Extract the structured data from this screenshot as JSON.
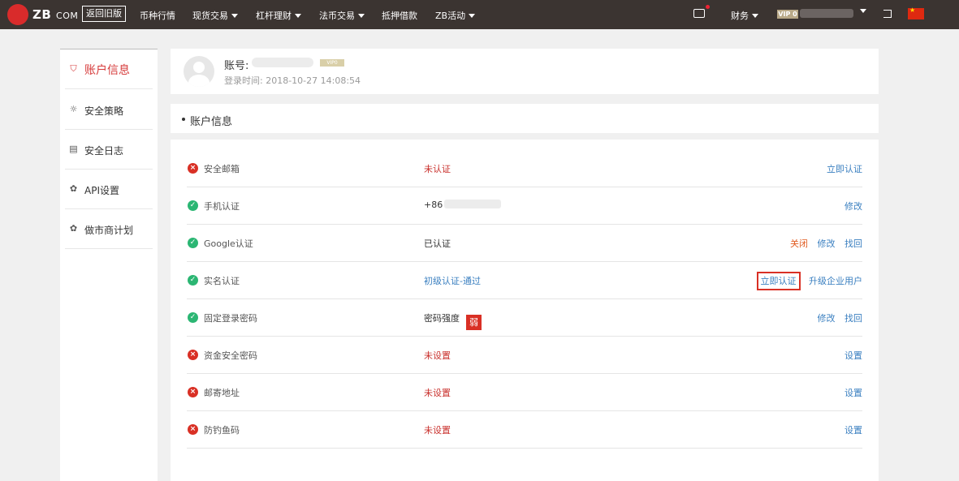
{
  "topbar": {
    "logo_text": "ZB",
    "logo_suffix": "COM",
    "old_version": "返回旧版",
    "nav": [
      {
        "label": "币种行情",
        "dropdown": false
      },
      {
        "label": "现货交易",
        "dropdown": true
      },
      {
        "label": "杠杆理财",
        "dropdown": true
      },
      {
        "label": "法币交易",
        "dropdown": true
      },
      {
        "label": "抵押借款",
        "dropdown": false
      },
      {
        "label": "ZB活动",
        "dropdown": true
      }
    ],
    "finance": "财务",
    "vip": "VIP 0",
    "message_icon": "message-icon",
    "logout_icon": "logout-icon",
    "flag_icon": "china-flag-icon"
  },
  "sidebar": {
    "items": [
      {
        "label": "账户信息",
        "icon": "user-icon",
        "active": true
      },
      {
        "label": "安全策略",
        "icon": "bulb-icon",
        "active": false
      },
      {
        "label": "安全日志",
        "icon": "document-icon",
        "active": false
      },
      {
        "label": "API设置",
        "icon": "api-icon",
        "active": false
      },
      {
        "label": "做市商计划",
        "icon": "api-icon",
        "active": false
      }
    ]
  },
  "profile": {
    "account_label": "账号:",
    "vip_tag": "VIP0",
    "login_time": "登录时间: 2018-10-27 14:08:54"
  },
  "section": {
    "title": "账户信息"
  },
  "rows": [
    {
      "name": "安全邮箱",
      "status": "bad",
      "value": "未认证",
      "value_style": "red",
      "actions": [
        "立即认证"
      ]
    },
    {
      "name": "手机认证",
      "status": "ok",
      "value": "+86",
      "value_style": "dark",
      "actions": [
        "修改"
      ]
    },
    {
      "name": "Google认证",
      "status": "ok",
      "value": "已认证",
      "value_style": "dark",
      "actions": [
        "关闭",
        "修改",
        "找回"
      ]
    },
    {
      "name": "实名认证",
      "status": "ok",
      "value": "初级认证-通过",
      "value_style": "blue",
      "actions": [
        "立即认证",
        "升级企业用户"
      ]
    },
    {
      "name": "固定登录密码",
      "status": "ok",
      "value": "密码强度",
      "value_style": "dark",
      "badge": "弱",
      "actions": [
        "修改",
        "找回"
      ]
    },
    {
      "name": "资金安全密码",
      "status": "bad",
      "value": "未设置",
      "value_style": "red",
      "actions": [
        "设置"
      ]
    },
    {
      "name": "邮寄地址",
      "status": "bad",
      "value": "未设置",
      "value_style": "red",
      "actions": [
        "设置"
      ]
    },
    {
      "name": "防钓鱼码",
      "status": "bad",
      "value": "未设置",
      "value_style": "red",
      "actions": [
        "设置"
      ]
    }
  ]
}
